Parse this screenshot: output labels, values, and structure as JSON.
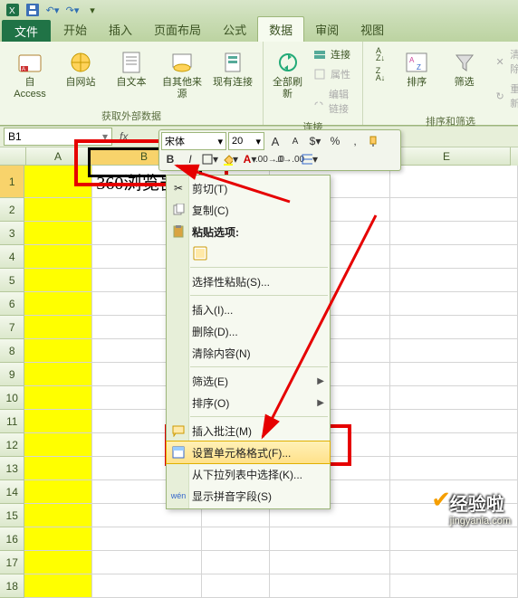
{
  "qat": {
    "dropdown_tip": "▾"
  },
  "tabs": {
    "file": "文件",
    "home": "开始",
    "insert": "插入",
    "layout": "页面布局",
    "formulas": "公式",
    "data": "数据",
    "review": "审阅",
    "view": "视图"
  },
  "ribbon": {
    "get_external": {
      "label": "获取外部数据",
      "access": "自 Access",
      "web": "自网站",
      "text": "自文本",
      "other": "自其他来源",
      "existing": "现有连接"
    },
    "connections": {
      "label": "连接",
      "refresh": "全部刷新",
      "conn": "连接",
      "prop": "属性",
      "edit": "编辑链接"
    },
    "sort_filter": {
      "label": "排序和筛选",
      "az": "A→Z",
      "za": "Z→A",
      "sort": "排序",
      "filter": "筛选",
      "clear": "清除",
      "reapply": "重新"
    }
  },
  "namebox": {
    "value": "B1"
  },
  "columns": [
    "A",
    "B",
    "C",
    "D",
    "E"
  ],
  "cell_value": "360浏览器",
  "mini": {
    "font": "宋体",
    "size": "20",
    "bold": "B",
    "italic": "I",
    "grow": "A",
    "shrink": "A",
    "percent": "%",
    "comma": ",",
    "currency": "$"
  },
  "ctx": {
    "cut": "剪切(T)",
    "copy": "复制(C)",
    "paste_opt": "粘贴选项:",
    "paste_special": "选择性粘贴(S)...",
    "insert": "插入(I)...",
    "delete": "删除(D)...",
    "clear": "清除内容(N)",
    "filter": "筛选(E)",
    "sort": "排序(O)",
    "insert_comment": "插入批注(M)",
    "format": "设置单元格格式(F)...",
    "dropdown": "从下拉列表中选择(K)...",
    "phonetic": "显示拼音字段(S)"
  },
  "watermark": {
    "title": "经验啦",
    "url": "jingyanla.com"
  }
}
